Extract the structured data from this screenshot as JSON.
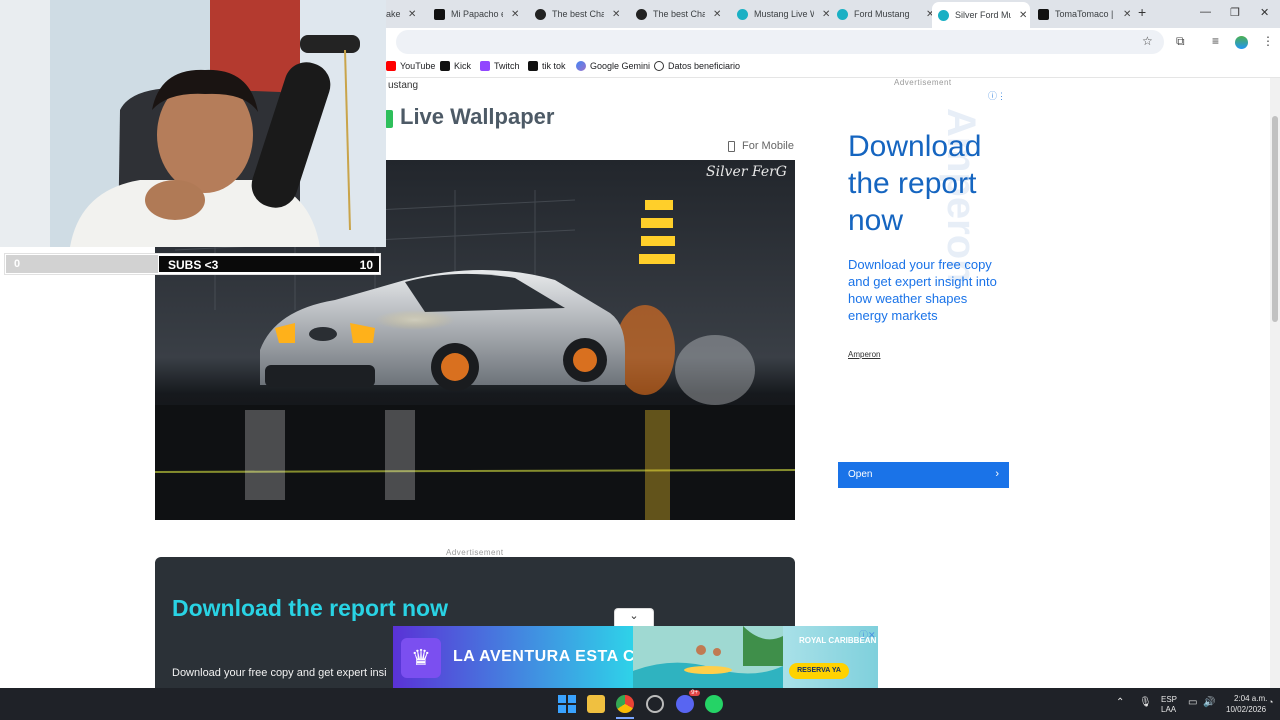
{
  "tabs": [
    {
      "label": "ake",
      "active": false
    },
    {
      "label": "Mi Papacho en",
      "active": false
    },
    {
      "label": "The best Chatb",
      "active": false
    },
    {
      "label": "The best Chatb",
      "active": false
    },
    {
      "label": "Mustang Live W",
      "active": false
    },
    {
      "label": "Ford Mustang",
      "active": false
    },
    {
      "label": "Silver Ford Mu",
      "active": true
    },
    {
      "label": "TomaTomaco |",
      "active": false
    }
  ],
  "new_tab_label": "+",
  "bookmarks": [
    {
      "label": "YouTube",
      "icon": "youtube-icon",
      "color": "#ff0000"
    },
    {
      "label": "Kick",
      "icon": "kick-icon",
      "color": "#53fc18"
    },
    {
      "label": "Twitch",
      "icon": "twitch-icon",
      "color": "#9146ff"
    },
    {
      "label": "tik tok",
      "icon": "tiktok-icon",
      "color": "#000000"
    },
    {
      "label": "Google Gemini",
      "icon": "gemini-icon",
      "color": "#4285f4"
    },
    {
      "label": "Datos beneficiario",
      "icon": "globe-icon",
      "color": "#333333"
    }
  ],
  "page": {
    "breadcrumb": "ustang",
    "title": "Live Wallpaper",
    "for_mobile": "For Mobile",
    "watermark": "Silver FerG",
    "ad_label": "Advertisement"
  },
  "bottom_ad": {
    "title": "Download the report now",
    "body": "Download your free copy and get expert insi"
  },
  "side_ad": {
    "headline": "Download the report now",
    "body": "Download your free copy and get expert insight into how weather shapes energy markets",
    "brand": "Amperon",
    "watermark": "Amperon",
    "cta": "Open"
  },
  "webcam": {
    "subs_start": "0",
    "subs_label": "SUBS <3",
    "subs_goal": "10"
  },
  "banner_ad": {
    "text": "LA AVENTURA ESTA CERCA",
    "brand": "ROYAL CARIBBEAN",
    "cta": "RESERVA YA"
  },
  "taskbar": {
    "lang": "ESP",
    "lang_sub": "LAA",
    "time": "2:04 a.m.",
    "date": "10/02/2026",
    "discord_badge": "9+"
  },
  "colors": {
    "accent": "#1a73e8",
    "title": "#4d5a66",
    "ad_cyan": "#29d3e4"
  }
}
